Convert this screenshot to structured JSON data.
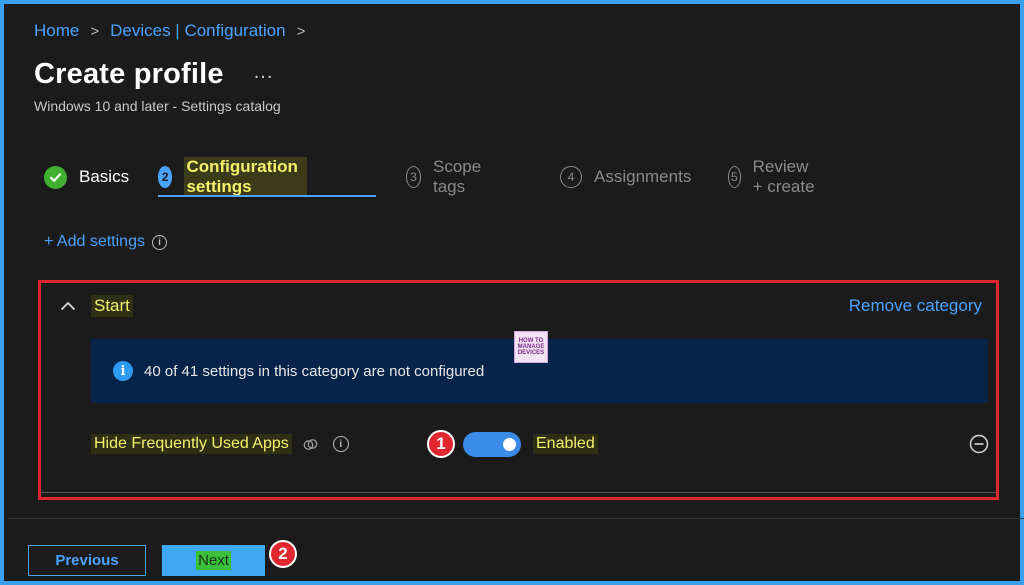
{
  "breadcrumb": {
    "items": [
      "Home",
      "Devices | Configuration"
    ],
    "separator": ">"
  },
  "header": {
    "title": "Create profile",
    "more": "...",
    "subtitle": "Windows 10 and later - Settings catalog"
  },
  "steps": [
    {
      "num": "",
      "label": "Basics",
      "state": "done"
    },
    {
      "num": "2",
      "label": "Configuration settings",
      "state": "active"
    },
    {
      "num": "3",
      "label": "Scope tags",
      "state": "inactive"
    },
    {
      "num": "4",
      "label": "Assignments",
      "state": "inactive"
    },
    {
      "num": "5",
      "label": "Review + create",
      "state": "inactive"
    }
  ],
  "add_settings": {
    "label": "+ Add settings",
    "info": "i"
  },
  "category": {
    "title": "Start",
    "remove_label": "Remove category",
    "banner_icon": "i",
    "banner_text": "40 of 41 settings in this category are not configured",
    "logo_lines": [
      "HOW TO",
      "MANAGE",
      "DEVICES"
    ],
    "setting": {
      "name": "Hide Frequently Used Apps",
      "info": "i",
      "toggle_on": true,
      "value_label": "Enabled"
    }
  },
  "annotations": {
    "marker_1": "1",
    "marker_2": "2"
  },
  "footer": {
    "previous_label": "Previous",
    "next_label": "Next"
  },
  "colors": {
    "accent": "#4aa3ff",
    "highlight_text": "#f4f16b",
    "annotation_red": "#e0262e",
    "success_green": "#3fb02f",
    "banner_bg": "#062449"
  }
}
